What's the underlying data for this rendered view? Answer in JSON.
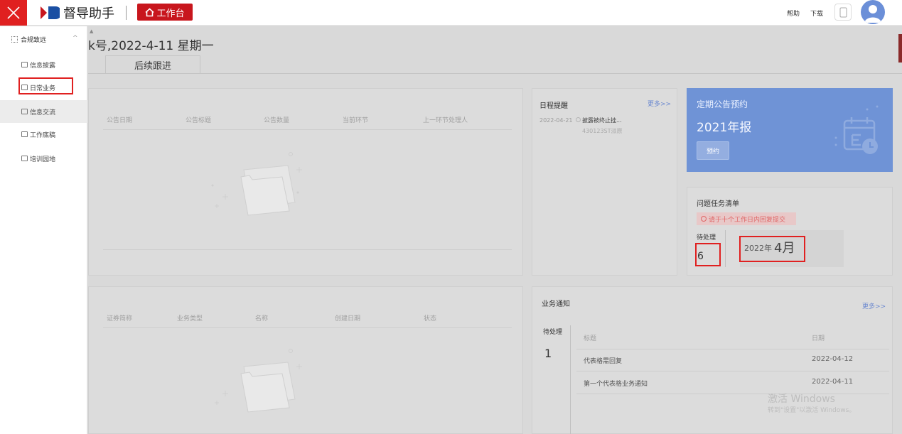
{
  "topbar": {
    "app_title": "督导助手",
    "workbench_label": "工作台",
    "help": "帮助",
    "download": "下载"
  },
  "sidebar": {
    "section": "合规致远",
    "items": [
      {
        "label": "信息披露"
      },
      {
        "label": "日常业务"
      },
      {
        "label": "信息交流"
      },
      {
        "label": "工作底稿"
      },
      {
        "label": "培训园地"
      }
    ]
  },
  "main": {
    "title": "k号,2022-4-11 星期一",
    "tab": "后续跟进",
    "announcements": {
      "columns": [
        "公告日期",
        "公告标题",
        "公告数量",
        "当前环节",
        "上一环节处理人"
      ]
    },
    "business": {
      "columns": [
        "证券简称",
        "业务类型",
        "名称",
        "创建日期",
        "状态"
      ]
    },
    "schedule": {
      "title": "日程提醒",
      "more": "更多>>",
      "items": [
        {
          "date": "2022-04-21",
          "text": "披露被终止挂...",
          "sub": "430123ST派原"
        }
      ]
    },
    "reservation": {
      "title": "定期公告预约",
      "year": "2021年报",
      "button": "预约"
    },
    "tasks": {
      "title": "问题任务清单",
      "warning": "请于十个工作日内回复提交",
      "pending_label": "待处理",
      "pending_count": "6",
      "month_prefix": "2022年",
      "month_big": "4月"
    },
    "notices": {
      "title": "业务通知",
      "more": "更多>>",
      "pending_label": "待处理",
      "pending_count": "1",
      "col_title": "标题",
      "col_date": "日期",
      "rows": [
        {
          "title": "代表格需回复",
          "date": "2022-04-12"
        },
        {
          "title": "第一个代表格业务通知",
          "date": "2022-04-11"
        }
      ]
    },
    "watermark": {
      "line1": "激活 Windows",
      "line2": "转到\"设置\"以激活 Windows。"
    }
  }
}
